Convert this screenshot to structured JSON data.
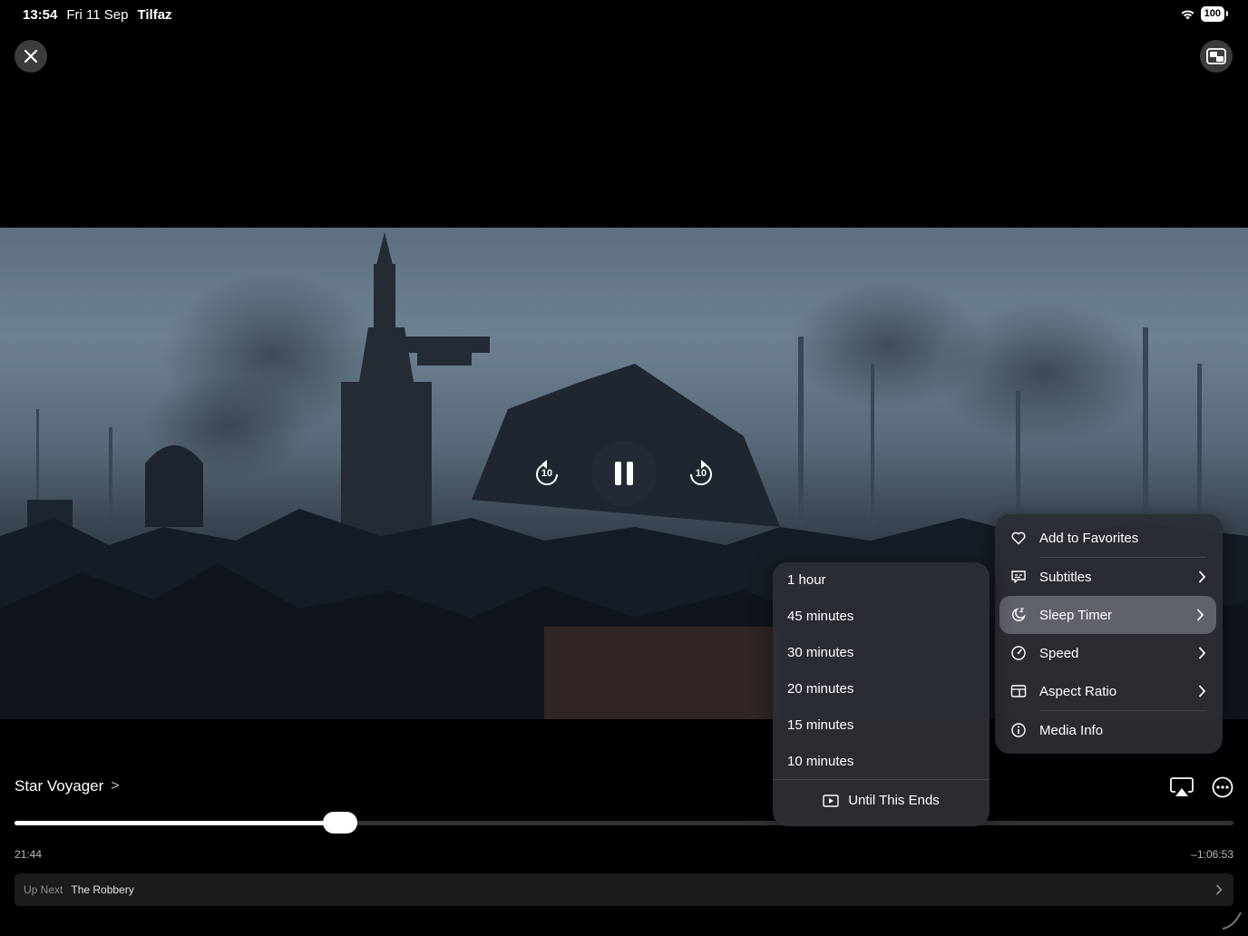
{
  "status_bar": {
    "time": "13:54",
    "date": "Fri 11 Sep",
    "carrier": "Tilfaz",
    "battery": "100"
  },
  "top_controls": {
    "close_icon": "close-icon",
    "pip_icon": "picture-in-picture-icon"
  },
  "playback": {
    "skip_back_label": "10",
    "skip_forward_label": "10",
    "state": "playing",
    "progress": 0.267
  },
  "title": {
    "text": "Star Voyager",
    "chevron": ">"
  },
  "time": {
    "elapsed": "21:44",
    "remaining": "–1:06:53"
  },
  "up_next": {
    "label": "Up Next",
    "title": "The Robbery"
  },
  "menu": {
    "items": [
      {
        "label": "Add to Favorites",
        "icon": "heart-icon"
      },
      {
        "label": "Subtitles",
        "icon": "subtitles-icon",
        "submenu": true
      },
      {
        "label": "Sleep Timer",
        "icon": "sleep-timer-icon",
        "submenu": true,
        "highlighted": true
      },
      {
        "label": "Speed",
        "icon": "speed-icon",
        "submenu": true
      },
      {
        "label": "Aspect Ratio",
        "icon": "aspect-ratio-icon",
        "submenu": true
      },
      {
        "label": "Media Info",
        "icon": "info-icon"
      }
    ]
  },
  "sleep_timer": {
    "options": [
      "1 hour",
      "45 minutes",
      "30 minutes",
      "20 minutes",
      "15 minutes",
      "10 minutes"
    ],
    "until_end": "Until This Ends"
  }
}
